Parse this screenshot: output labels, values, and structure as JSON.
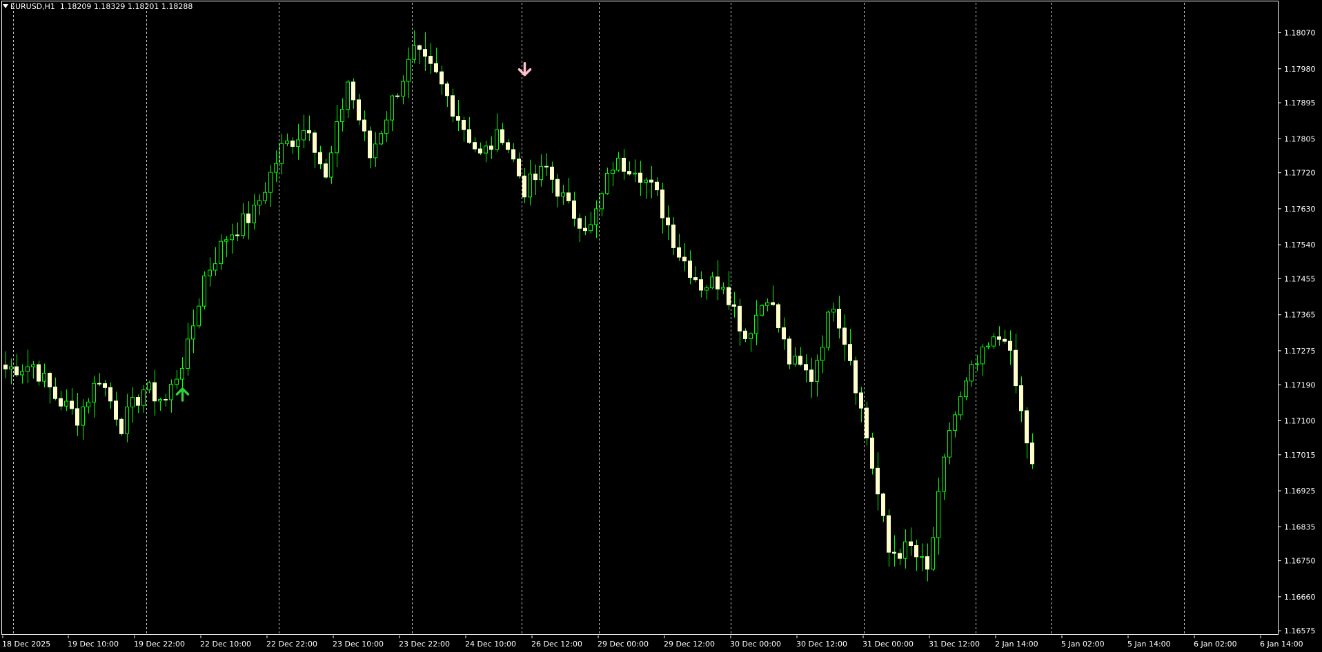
{
  "header": {
    "symbol": "EURUSD,H1",
    "ohlc": "1.18209 1.18329 1.18201 1.18288"
  },
  "colors": {
    "background": "#000000",
    "grid": "#c8c8c8",
    "axis": "#ffffff",
    "bull_body": "#000000",
    "bull_border": "#00ff00",
    "bear_body": "#ffffcc",
    "wick": "#00ff00",
    "arrow_up": "#2ed13b",
    "arrow_down": "#ffc0cb"
  },
  "chart_data": {
    "type": "candlestick",
    "y_ticks": [
      "1.18070",
      "1.17980",
      "1.17895",
      "1.17805",
      "1.17720",
      "1.17630",
      "1.17540",
      "1.17455",
      "1.17365",
      "1.17275",
      "1.17190",
      "1.17100",
      "1.17015",
      "1.16925",
      "1.16835",
      "1.16750",
      "1.16660",
      "1.16575"
    ],
    "ylim": [
      1.16565,
      1.18145
    ],
    "x_ticks": [
      "18 Dec 2025",
      "19 Dec 10:00",
      "19 Dec 22:00",
      "22 Dec 10:00",
      "22 Dec 22:00",
      "23 Dec 10:00",
      "23 Dec 22:00",
      "24 Dec 10:00",
      "26 Dec 12:00",
      "29 Dec 00:00",
      "29 Dec 12:00",
      "30 Dec 00:00",
      "30 Dec 12:00",
      "31 Dec 00:00",
      "31 Dec 12:00",
      "2 Jan 14:00",
      "5 Jan 02:00",
      "5 Jan 14:00",
      "6 Jan 02:00",
      "6 Jan 14:00"
    ],
    "grid_at_tick_index": [
      1,
      2,
      4,
      6,
      8,
      9,
      11,
      13,
      14,
      15,
      17,
      18
    ],
    "arrows": [
      {
        "type": "buy",
        "bar": 32,
        "price": 1.17175
      },
      {
        "type": "sell",
        "bar": 94,
        "price": 1.1798
      }
    ],
    "close_path": [
      [
        0,
        1.1723
      ],
      [
        5,
        1.1724
      ],
      [
        9,
        1.1716
      ],
      [
        13,
        1.1711
      ],
      [
        17,
        1.1721
      ],
      [
        21,
        1.1709
      ],
      [
        25,
        1.1718
      ],
      [
        29,
        1.1715
      ],
      [
        33,
        1.1728
      ],
      [
        36,
        1.1746
      ],
      [
        40,
        1.1756
      ],
      [
        45,
        1.1762
      ],
      [
        50,
        1.1778
      ],
      [
        55,
        1.1784
      ],
      [
        58,
        1.177
      ],
      [
        62,
        1.1795
      ],
      [
        66,
        1.1776
      ],
      [
        70,
        1.179
      ],
      [
        74,
        1.1802
      ],
      [
        78,
        1.1796
      ],
      [
        82,
        1.1786
      ],
      [
        86,
        1.1776
      ],
      [
        90,
        1.1782
      ],
      [
        94,
        1.1768
      ],
      [
        98,
        1.1773
      ],
      [
        102,
        1.1763
      ],
      [
        106,
        1.1758
      ],
      [
        110,
        1.1774
      ],
      [
        114,
        1.1774
      ],
      [
        118,
        1.1766
      ],
      [
        122,
        1.1752
      ],
      [
        126,
        1.1744
      ],
      [
        130,
        1.1745
      ],
      [
        134,
        1.1731
      ],
      [
        138,
        1.1742
      ],
      [
        142,
        1.1725
      ],
      [
        146,
        1.1721
      ],
      [
        150,
        1.174
      ],
      [
        153,
        1.1726
      ],
      [
        156,
        1.1706
      ],
      [
        160,
        1.1677
      ],
      [
        164,
        1.1678
      ],
      [
        167,
        1.1672
      ],
      [
        171,
        1.1708
      ],
      [
        175,
        1.1722
      ],
      [
        178,
        1.1728
      ],
      [
        181,
        1.1732
      ],
      [
        185,
        1.1705
      ],
      [
        186,
        1.1698
      ]
    ]
  }
}
